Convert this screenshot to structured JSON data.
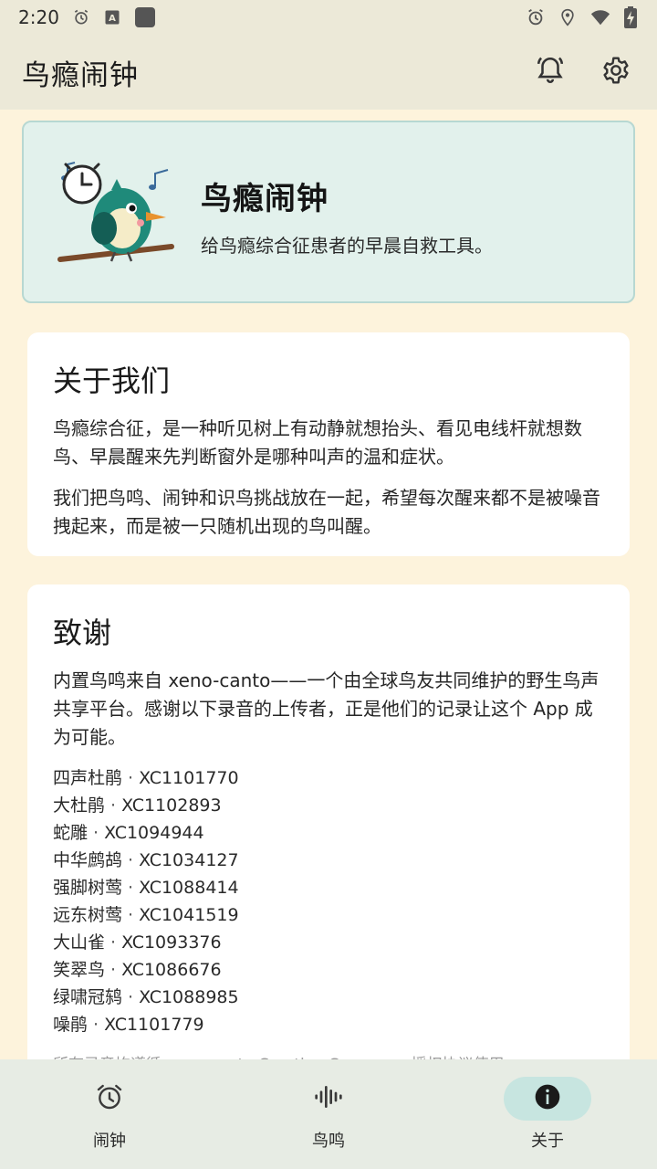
{
  "status_bar": {
    "time": "2:20",
    "left_icons": [
      "alarm-icon",
      "font-icon",
      "app-square-icon"
    ],
    "right_icons": [
      "alarm-icon",
      "location-icon",
      "wifi-icon",
      "battery-charging-icon"
    ]
  },
  "app_bar": {
    "title": "鸟瘾闹钟",
    "actions": [
      "notification-bell-icon",
      "settings-gear-icon"
    ]
  },
  "hero": {
    "title": "鸟瘾闹钟",
    "subtitle": "给鸟瘾综合征患者的早晨自救工具。"
  },
  "about": {
    "heading": "关于我们",
    "paragraphs": [
      "鸟瘾综合征，是一种听见树上有动静就想抬头、看见电线杆就想数鸟、早晨醒来先判断窗外是哪种叫声的温和症状。",
      "我们把鸟鸣、闹钟和识鸟挑战放在一起，希望每次醒来都不是被噪音拽起来，而是被一只随机出现的鸟叫醒。"
    ]
  },
  "thanks": {
    "heading": "致谢",
    "intro": "内置鸟鸣来自 xeno-canto——一个由全球鸟友共同维护的野生鸟声共享平台。感谢以下录音的上传者，正是他们的记录让这个 App 成为可能。",
    "separator": "·",
    "credits": [
      {
        "bird": "四声杜鹃",
        "id": "XC1101770"
      },
      {
        "bird": "大杜鹃",
        "id": "XC1102893"
      },
      {
        "bird": "蛇雕",
        "id": "XC1094944"
      },
      {
        "bird": "中华鹧鸪",
        "id": "XC1034127"
      },
      {
        "bird": "强脚树莺",
        "id": "XC1088414"
      },
      {
        "bird": "远东树莺",
        "id": "XC1041519"
      },
      {
        "bird": "大山雀",
        "id": "XC1093376"
      },
      {
        "bird": "笑翠鸟",
        "id": "XC1086676"
      },
      {
        "bird": "绿啸冠鸫",
        "id": "XC1088985"
      },
      {
        "bird": "噪鹃",
        "id": "XC1101779"
      }
    ],
    "license_note": "所有录音均遵循 xeno-canto Creative Commons 授权协议使用。"
  },
  "bottom_nav": {
    "items": [
      {
        "label": "闹钟",
        "icon": "alarm-clock-icon",
        "active": false
      },
      {
        "label": "鸟鸣",
        "icon": "sound-wave-icon",
        "active": false
      },
      {
        "label": "关于",
        "icon": "info-icon",
        "active": true
      }
    ]
  },
  "colors": {
    "background": "#fdf3dc",
    "app_bar": "#ece9d8",
    "hero_bg": "#e2f1ec",
    "hero_border": "#b7d8d2",
    "nav_bg": "#e7ece4",
    "nav_active_pill": "#c7e5e0"
  }
}
